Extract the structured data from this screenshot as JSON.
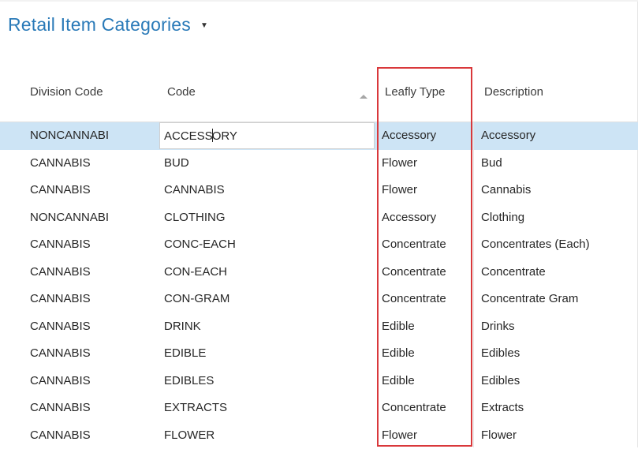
{
  "page": {
    "title": "Retail Item Categories"
  },
  "columns": {
    "division_code": "Division Code",
    "code": "Code",
    "leafly_type": "Leafly Type",
    "description": "Description"
  },
  "rows": [
    {
      "division": "NONCANNABI",
      "code_before_caret": "ACCESS",
      "code_after_caret": "ORY",
      "type": "Accessory",
      "description": "Accessory"
    },
    {
      "division": "CANNABIS",
      "code": "BUD",
      "type": "Flower",
      "description": "Bud"
    },
    {
      "division": "CANNABIS",
      "code": "CANNABIS",
      "type": "Flower",
      "description": "Cannabis"
    },
    {
      "division": "NONCANNABI",
      "code": "CLOTHING",
      "type": "Accessory",
      "description": "Clothing"
    },
    {
      "division": "CANNABIS",
      "code": "CONC-EACH",
      "type": "Concentrate",
      "description": "Concentrates (Each)"
    },
    {
      "division": "CANNABIS",
      "code": "CON-EACH",
      "type": "Concentrate",
      "description": "Concentrate"
    },
    {
      "division": "CANNABIS",
      "code": "CON-GRAM",
      "type": "Concentrate",
      "description": "Concentrate Gram"
    },
    {
      "division": "CANNABIS",
      "code": "DRINK",
      "type": "Edible",
      "description": "Drinks"
    },
    {
      "division": "CANNABIS",
      "code": "EDIBLE",
      "type": "Edible",
      "description": "Edibles"
    },
    {
      "division": "CANNABIS",
      "code": "EDIBLES",
      "type": "Edible",
      "description": "Edibles"
    },
    {
      "division": "CANNABIS",
      "code": "EXTRACTS",
      "type": "Concentrate",
      "description": "Extracts"
    },
    {
      "division": "CANNABIS",
      "code": "FLOWER",
      "type": "Flower",
      "description": "Flower"
    }
  ],
  "colors": {
    "title": "#2a7ab8",
    "selected_row": "#cde4f5",
    "highlight_box": "#d9383b"
  },
  "icons": {
    "title_dropdown": "chevron-down-icon",
    "sort": "sort-ascending-icon"
  }
}
